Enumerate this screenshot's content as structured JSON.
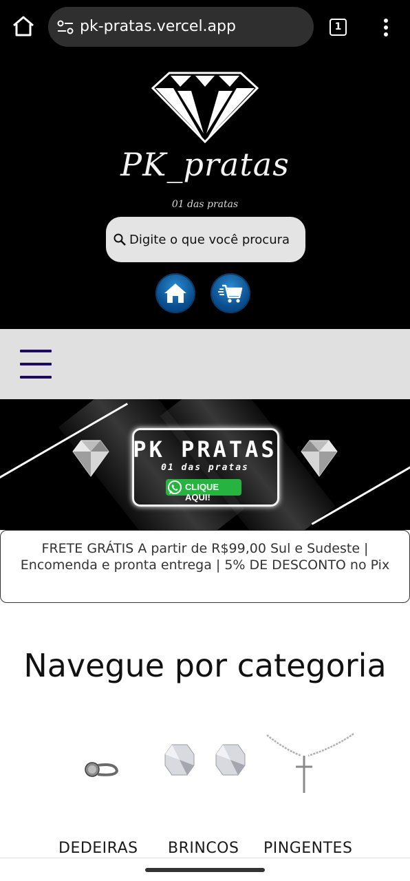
{
  "browser": {
    "url": "pk-pratas.vercel.app",
    "tab_count": "1",
    "icons": [
      "home-icon",
      "site-settings-icon",
      "tab-switcher-icon",
      "more-vert-icon"
    ]
  },
  "header": {
    "brand_name": "PK_pratas",
    "tagline": "01 das pratas",
    "search_placeholder": "Digite o que você procura",
    "icons": [
      "diamond-logo",
      "search-icon",
      "home-icon",
      "cart-icon"
    ]
  },
  "nav": {
    "icon": "hamburger-menu-icon"
  },
  "banner": {
    "title": "PK PRATAS",
    "tagline": "01 das pratas",
    "cta": "CLIQUE AQUI!",
    "icons": [
      "whatsapp-icon",
      "gem-icon"
    ]
  },
  "notice": {
    "text": "FRETE GRÁTIS A partir de R$99,00 Sul e Sudeste | Encomenda e pronta entrega | 5% DE DESCONTO no Pix"
  },
  "categories": {
    "heading": "Navegue por categoria",
    "items": [
      {
        "label": "DEDEIRAS",
        "icon": "ring-image"
      },
      {
        "label": "BRINCOS",
        "icon": "earrings-image"
      },
      {
        "label": "PINGENTES",
        "icon": "necklace-image"
      }
    ]
  },
  "colors": {
    "header_bg": "#000000",
    "navbar_bg": "#e0e0e0",
    "hamburger": "#1b0b5c",
    "round_button": "#0a4f8f",
    "whatsapp_green": "#26b33f"
  }
}
